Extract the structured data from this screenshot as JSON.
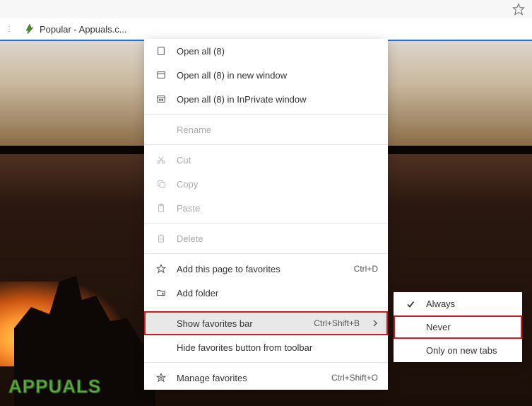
{
  "bookmark": {
    "label": "Popular - Appuals.c..."
  },
  "menu1": {
    "open_all": "Open all (8)",
    "open_all_window": "Open all (8) in new window",
    "open_all_inprivate": "Open all (8) in InPrivate window",
    "rename": "Rename",
    "cut": "Cut",
    "copy": "Copy",
    "paste": "Paste",
    "delete": "Delete",
    "add_page": "Add this page to favorites",
    "add_page_shortcut": "Ctrl+D",
    "add_folder": "Add folder",
    "show_bar": "Show favorites bar",
    "show_bar_shortcut": "Ctrl+Shift+B",
    "hide_button": "Hide favorites button from toolbar",
    "manage": "Manage favorites",
    "manage_shortcut": "Ctrl+Shift+O"
  },
  "menu2": {
    "always": "Always",
    "never": "Never",
    "new_tabs": "Only on new tabs"
  },
  "logo": "APPUALS"
}
